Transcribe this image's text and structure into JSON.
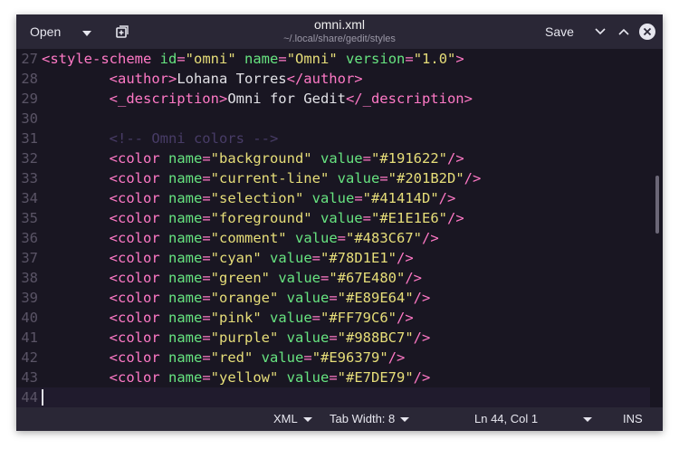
{
  "titlebar": {
    "open_label": "Open",
    "new_tab_icon": "new-document-icon",
    "title": "omni.xml",
    "subtitle": "~/.local/share/gedit/styles",
    "save_label": "Save"
  },
  "editor": {
    "lines": [
      {
        "n": "27",
        "tokens": [
          {
            "t": "tag",
            "v": "<style-scheme "
          },
          {
            "t": "attr",
            "v": "id"
          },
          {
            "t": "tag",
            "v": "="
          },
          {
            "t": "val",
            "v": "\"omni\""
          },
          {
            "t": "text",
            "v": " "
          },
          {
            "t": "attr",
            "v": "name"
          },
          {
            "t": "tag",
            "v": "="
          },
          {
            "t": "val",
            "v": "\"Omni\""
          },
          {
            "t": "text",
            "v": " "
          },
          {
            "t": "attr",
            "v": "version"
          },
          {
            "t": "tag",
            "v": "="
          },
          {
            "t": "val",
            "v": "\"1.0\""
          },
          {
            "t": "tag",
            "v": ">"
          }
        ]
      },
      {
        "n": "28",
        "tokens": [
          {
            "t": "text",
            "v": "        "
          },
          {
            "t": "tag",
            "v": "<author>"
          },
          {
            "t": "text",
            "v": "Lohana Torres"
          },
          {
            "t": "tag",
            "v": "</author>"
          }
        ]
      },
      {
        "n": "29",
        "tokens": [
          {
            "t": "text",
            "v": "        "
          },
          {
            "t": "tag",
            "v": "<_description>"
          },
          {
            "t": "text",
            "v": "Omni for Gedit"
          },
          {
            "t": "tag",
            "v": "</_description>"
          }
        ]
      },
      {
        "n": "30",
        "tokens": []
      },
      {
        "n": "31",
        "tokens": [
          {
            "t": "text",
            "v": "        "
          },
          {
            "t": "comment",
            "v": "<!-- Omni colors -->"
          }
        ]
      },
      {
        "n": "32",
        "tokens": [
          {
            "t": "text",
            "v": "        "
          },
          {
            "t": "tag",
            "v": "<color "
          },
          {
            "t": "attr",
            "v": "name"
          },
          {
            "t": "tag",
            "v": "="
          },
          {
            "t": "val",
            "v": "\"background\""
          },
          {
            "t": "text",
            "v": " "
          },
          {
            "t": "attr",
            "v": "value"
          },
          {
            "t": "tag",
            "v": "="
          },
          {
            "t": "val",
            "v": "\"#191622\""
          },
          {
            "t": "tag",
            "v": "/>"
          }
        ]
      },
      {
        "n": "33",
        "tokens": [
          {
            "t": "text",
            "v": "        "
          },
          {
            "t": "tag",
            "v": "<color "
          },
          {
            "t": "attr",
            "v": "name"
          },
          {
            "t": "tag",
            "v": "="
          },
          {
            "t": "val",
            "v": "\"current-line\""
          },
          {
            "t": "text",
            "v": " "
          },
          {
            "t": "attr",
            "v": "value"
          },
          {
            "t": "tag",
            "v": "="
          },
          {
            "t": "val",
            "v": "\"#201B2D\""
          },
          {
            "t": "tag",
            "v": "/>"
          }
        ]
      },
      {
        "n": "34",
        "tokens": [
          {
            "t": "text",
            "v": "        "
          },
          {
            "t": "tag",
            "v": "<color "
          },
          {
            "t": "attr",
            "v": "name"
          },
          {
            "t": "tag",
            "v": "="
          },
          {
            "t": "val",
            "v": "\"selection\""
          },
          {
            "t": "text",
            "v": " "
          },
          {
            "t": "attr",
            "v": "value"
          },
          {
            "t": "tag",
            "v": "="
          },
          {
            "t": "val",
            "v": "\"#41414D\""
          },
          {
            "t": "tag",
            "v": "/>"
          }
        ]
      },
      {
        "n": "35",
        "tokens": [
          {
            "t": "text",
            "v": "        "
          },
          {
            "t": "tag",
            "v": "<color "
          },
          {
            "t": "attr",
            "v": "name"
          },
          {
            "t": "tag",
            "v": "="
          },
          {
            "t": "val",
            "v": "\"foreground\""
          },
          {
            "t": "text",
            "v": " "
          },
          {
            "t": "attr",
            "v": "value"
          },
          {
            "t": "tag",
            "v": "="
          },
          {
            "t": "val",
            "v": "\"#E1E1E6\""
          },
          {
            "t": "tag",
            "v": "/>"
          }
        ]
      },
      {
        "n": "36",
        "tokens": [
          {
            "t": "text",
            "v": "        "
          },
          {
            "t": "tag",
            "v": "<color "
          },
          {
            "t": "attr",
            "v": "name"
          },
          {
            "t": "tag",
            "v": "="
          },
          {
            "t": "val",
            "v": "\"comment\""
          },
          {
            "t": "text",
            "v": " "
          },
          {
            "t": "attr",
            "v": "value"
          },
          {
            "t": "tag",
            "v": "="
          },
          {
            "t": "val",
            "v": "\"#483C67\""
          },
          {
            "t": "tag",
            "v": "/>"
          }
        ]
      },
      {
        "n": "37",
        "tokens": [
          {
            "t": "text",
            "v": "        "
          },
          {
            "t": "tag",
            "v": "<color "
          },
          {
            "t": "attr",
            "v": "name"
          },
          {
            "t": "tag",
            "v": "="
          },
          {
            "t": "val",
            "v": "\"cyan\""
          },
          {
            "t": "text",
            "v": " "
          },
          {
            "t": "attr",
            "v": "value"
          },
          {
            "t": "tag",
            "v": "="
          },
          {
            "t": "val",
            "v": "\"#78D1E1\""
          },
          {
            "t": "tag",
            "v": "/>"
          }
        ]
      },
      {
        "n": "38",
        "tokens": [
          {
            "t": "text",
            "v": "        "
          },
          {
            "t": "tag",
            "v": "<color "
          },
          {
            "t": "attr",
            "v": "name"
          },
          {
            "t": "tag",
            "v": "="
          },
          {
            "t": "val",
            "v": "\"green\""
          },
          {
            "t": "text",
            "v": " "
          },
          {
            "t": "attr",
            "v": "value"
          },
          {
            "t": "tag",
            "v": "="
          },
          {
            "t": "val",
            "v": "\"#67E480\""
          },
          {
            "t": "tag",
            "v": "/>"
          }
        ]
      },
      {
        "n": "39",
        "tokens": [
          {
            "t": "text",
            "v": "        "
          },
          {
            "t": "tag",
            "v": "<color "
          },
          {
            "t": "attr",
            "v": "name"
          },
          {
            "t": "tag",
            "v": "="
          },
          {
            "t": "val",
            "v": "\"orange\""
          },
          {
            "t": "text",
            "v": " "
          },
          {
            "t": "attr",
            "v": "value"
          },
          {
            "t": "tag",
            "v": "="
          },
          {
            "t": "val",
            "v": "\"#E89E64\""
          },
          {
            "t": "tag",
            "v": "/>"
          }
        ]
      },
      {
        "n": "40",
        "tokens": [
          {
            "t": "text",
            "v": "        "
          },
          {
            "t": "tag",
            "v": "<color "
          },
          {
            "t": "attr",
            "v": "name"
          },
          {
            "t": "tag",
            "v": "="
          },
          {
            "t": "val",
            "v": "\"pink\""
          },
          {
            "t": "text",
            "v": " "
          },
          {
            "t": "attr",
            "v": "value"
          },
          {
            "t": "tag",
            "v": "="
          },
          {
            "t": "val",
            "v": "\"#FF79C6\""
          },
          {
            "t": "tag",
            "v": "/>"
          }
        ]
      },
      {
        "n": "41",
        "tokens": [
          {
            "t": "text",
            "v": "        "
          },
          {
            "t": "tag",
            "v": "<color "
          },
          {
            "t": "attr",
            "v": "name"
          },
          {
            "t": "tag",
            "v": "="
          },
          {
            "t": "val",
            "v": "\"purple\""
          },
          {
            "t": "text",
            "v": " "
          },
          {
            "t": "attr",
            "v": "value"
          },
          {
            "t": "tag",
            "v": "="
          },
          {
            "t": "val",
            "v": "\"#988BC7\""
          },
          {
            "t": "tag",
            "v": "/>"
          }
        ]
      },
      {
        "n": "42",
        "tokens": [
          {
            "t": "text",
            "v": "        "
          },
          {
            "t": "tag",
            "v": "<color "
          },
          {
            "t": "attr",
            "v": "name"
          },
          {
            "t": "tag",
            "v": "="
          },
          {
            "t": "val",
            "v": "\"red\""
          },
          {
            "t": "text",
            "v": " "
          },
          {
            "t": "attr",
            "v": "value"
          },
          {
            "t": "tag",
            "v": "="
          },
          {
            "t": "val",
            "v": "\"#E96379\""
          },
          {
            "t": "tag",
            "v": "/>"
          }
        ]
      },
      {
        "n": "43",
        "tokens": [
          {
            "t": "text",
            "v": "        "
          },
          {
            "t": "tag",
            "v": "<color "
          },
          {
            "t": "attr",
            "v": "name"
          },
          {
            "t": "tag",
            "v": "="
          },
          {
            "t": "val",
            "v": "\"yellow\""
          },
          {
            "t": "text",
            "v": " "
          },
          {
            "t": "attr",
            "v": "value"
          },
          {
            "t": "tag",
            "v": "="
          },
          {
            "t": "val",
            "v": "\"#E7DE79\""
          },
          {
            "t": "tag",
            "v": "/>"
          }
        ]
      },
      {
        "n": "44",
        "tokens": [],
        "current": true
      }
    ]
  },
  "statusbar": {
    "language": "XML",
    "tab_width": "Tab Width: 8",
    "position": "Ln 44, Col 1",
    "mode": "INS"
  },
  "colors": {
    "background": "#191622",
    "current_line": "#201b2d",
    "chrome": "#2a2736",
    "tag": "#ff79c6",
    "attr": "#67e480",
    "value": "#e7de79",
    "comment": "#483c67",
    "foreground": "#e1e1e6"
  }
}
